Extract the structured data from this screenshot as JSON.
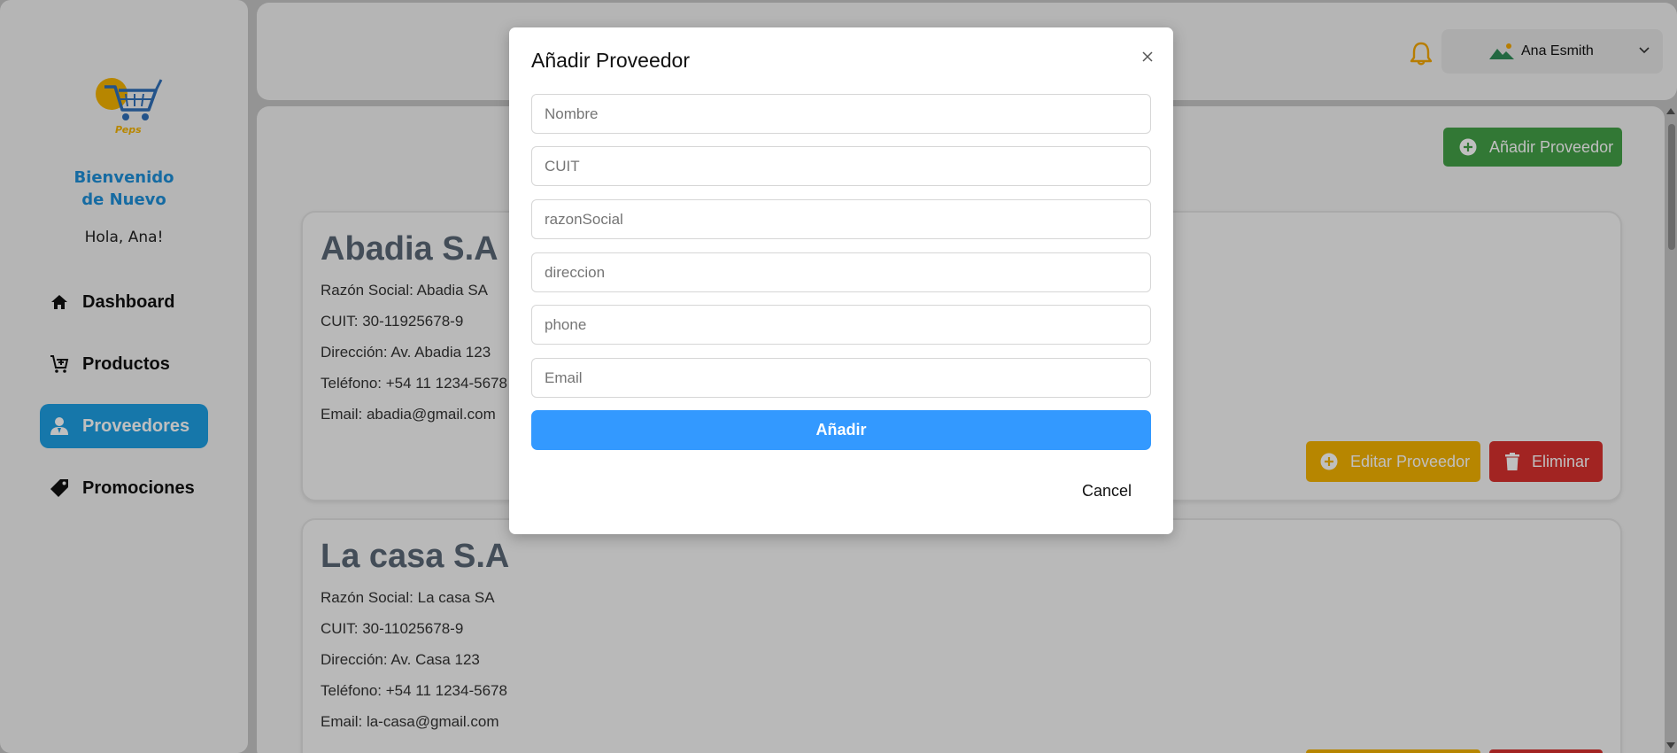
{
  "sidebar": {
    "logo_text": "Peps",
    "welcome": "Bienvenido de Nuevo",
    "greeting": "Hola, Ana!",
    "items": [
      {
        "label": "Dashboard",
        "icon": "home-icon"
      },
      {
        "label": "Productos",
        "icon": "cart-icon"
      },
      {
        "label": "Proveedores",
        "icon": "user-icon",
        "active": true
      },
      {
        "label": "Promociones",
        "icon": "tag-icon"
      }
    ]
  },
  "header": {
    "user_name": "Ana Esmith",
    "icons": [
      "bell-icon",
      "landscape-icon",
      "chevron-down-icon"
    ]
  },
  "main": {
    "add_button_label": "Añadir Proveedor",
    "cards": [
      {
        "name": "Abadia S.A",
        "razon_social": "Razón Social: Abadia SA",
        "cuit": "CUIT: 30-11925678-9",
        "direccion": "Dirección: Av. Abadia 123",
        "telefono": "Teléfono: +54 11 1234-5678",
        "email": "Email: abadia@gmail.com",
        "edit_label": "Editar Proveedor",
        "delete_label": "Eliminar"
      },
      {
        "name": "La casa S.A",
        "razon_social": "Razón Social: La casa SA",
        "cuit": "CUIT: 30-11025678-9",
        "direccion": "Dirección: Av. Casa 123",
        "telefono": "Teléfono: +54 11 1234-5678",
        "email": "Email: la-casa@gmail.com"
      }
    ]
  },
  "modal": {
    "title": "Añadir Proveedor",
    "fields": [
      {
        "placeholder": "Nombre",
        "value": ""
      },
      {
        "placeholder": "CUIT",
        "value": ""
      },
      {
        "placeholder": "razonSocial",
        "value": ""
      },
      {
        "placeholder": "direccion",
        "value": ""
      },
      {
        "placeholder": "phone",
        "value": ""
      },
      {
        "placeholder": "Email",
        "value": ""
      }
    ],
    "submit_label": "Añadir",
    "cancel_label": "Cancel"
  },
  "colors": {
    "accent_blue": "#1e9fe3",
    "submit_blue": "#3399ff",
    "add_green": "#43a047",
    "edit_yellow": "#f5b301",
    "delete_red": "#d9312e"
  }
}
